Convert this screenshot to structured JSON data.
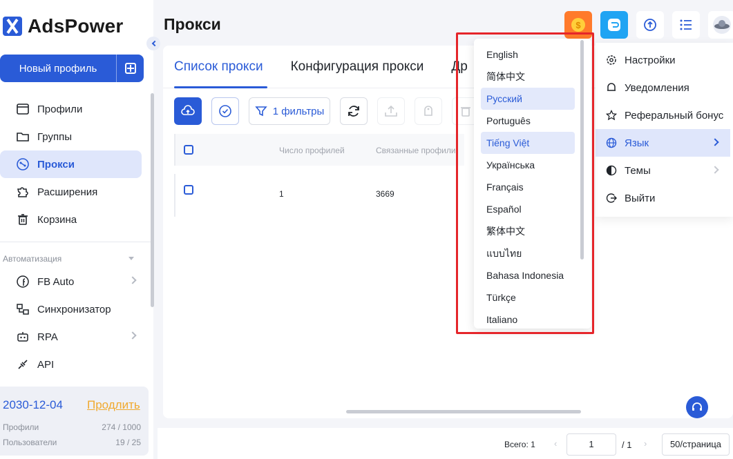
{
  "app": {
    "name": "AdsPower"
  },
  "sidebar": {
    "new_profile_label": "Новый профиль",
    "items": [
      {
        "label": "Профили",
        "icon": "profiles-icon"
      },
      {
        "label": "Группы",
        "icon": "folder-icon"
      },
      {
        "label": "Прокси",
        "icon": "proxy-icon",
        "active": true
      },
      {
        "label": "Расширения",
        "icon": "puzzle-icon"
      },
      {
        "label": "Корзина",
        "icon": "trash-icon"
      }
    ],
    "automation_label": "Автоматизация",
    "automation_items": [
      {
        "label": "FB Auto",
        "icon": "fb-icon"
      },
      {
        "label": "Синхронизатор",
        "icon": "sync-icon"
      },
      {
        "label": "RPA",
        "icon": "robot-icon"
      },
      {
        "label": "API",
        "icon": "api-icon"
      }
    ],
    "subscription": {
      "date": "2030-12-04",
      "renew_label": "Продлить",
      "profiles_label": "Профили",
      "profiles_value": "274 / 1000",
      "users_label": "Пользователи",
      "users_value": "19 / 25"
    }
  },
  "header": {
    "title": "Прокси"
  },
  "tabs": [
    {
      "label": "Список прокси",
      "active": true
    },
    {
      "label": "Конфигурация прокси"
    },
    {
      "label": "Др"
    }
  ],
  "toolbar": {
    "filter_label": "1 фильтры"
  },
  "table": {
    "columns": [
      "Число профилей",
      "Связанные профили"
    ],
    "rows": [
      {
        "profiles": "1",
        "linked": "3669"
      }
    ]
  },
  "language_menu": {
    "items": [
      "English",
      "简体中文",
      "Русский",
      "Português",
      "Tiếng Việt",
      "Українська",
      "Français",
      "Español",
      "繁体中文",
      "แบบไทย",
      "Bahasa Indonesia",
      "Türkçe",
      "Italiano"
    ],
    "selected": "Русский",
    "hovered": "Tiếng Việt"
  },
  "user_menu": {
    "items": [
      {
        "label": "Настройки",
        "icon": "settings-icon"
      },
      {
        "label": "Уведомления",
        "icon": "bell-icon"
      },
      {
        "label": "Реферальный бонус",
        "icon": "star-icon"
      },
      {
        "label": "Язык",
        "icon": "globe-icon",
        "active": true
      },
      {
        "label": "Темы",
        "icon": "theme-icon"
      },
      {
        "label": "Выйти",
        "icon": "logout-icon"
      }
    ]
  },
  "pagination": {
    "total_label": "Всего: 1",
    "page": "1",
    "of_label": "/ 1",
    "page_size": "50/страница"
  },
  "colors": {
    "accent": "#2a5bd7",
    "highlight": "#e5252a",
    "renew": "#f0a92e"
  }
}
